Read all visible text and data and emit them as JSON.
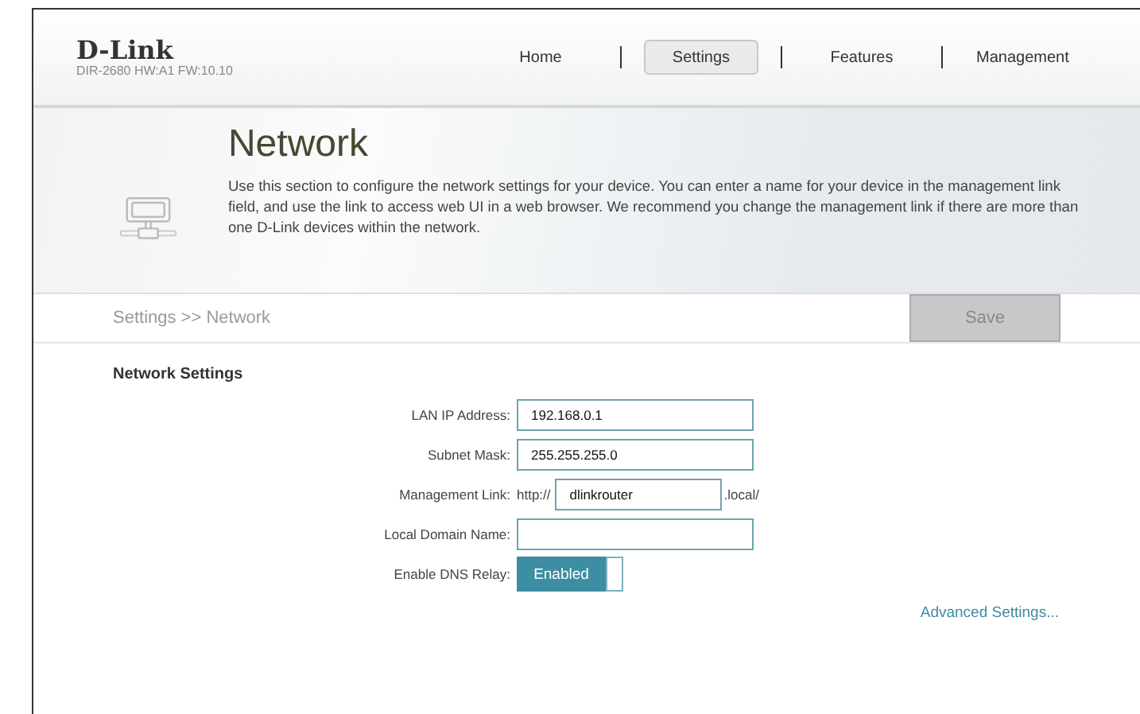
{
  "header": {
    "logo": "D-Link",
    "model": "DIR-2680 HW:A1 FW:10.10"
  },
  "nav": [
    {
      "label": "Home",
      "selected": false
    },
    {
      "label": "Settings",
      "selected": true
    },
    {
      "label": "Features",
      "selected": false
    },
    {
      "label": "Management",
      "selected": false
    }
  ],
  "banner": {
    "title": "Network",
    "description": "Use this section to configure the network settings for your device. You can enter a name for your device in the management link field, and use the link to access web UI in a web browser. We recommend you change the management link if there are more than one D-Link devices within the network."
  },
  "breadcrumb": "Settings >> Network",
  "save_button": "Save",
  "section_title": "Network Settings",
  "fields": [
    {
      "kind": "text",
      "label": "LAN IP Address:",
      "value": "192.168.0.1"
    },
    {
      "kind": "text",
      "label": "Subnet Mask:",
      "value": "255.255.255.0"
    },
    {
      "kind": "link",
      "label": "Management Link:",
      "prefix": "http://",
      "value": "dlinkrouter",
      "suffix": ".local/"
    },
    {
      "kind": "text",
      "label": "Local Domain Name:"
    },
    {
      "kind": "toggle",
      "label": "Enable DNS Relay:",
      "on": true,
      "state_text": "Enabled"
    }
  ],
  "advanced_link": "Advanced Settings..."
}
